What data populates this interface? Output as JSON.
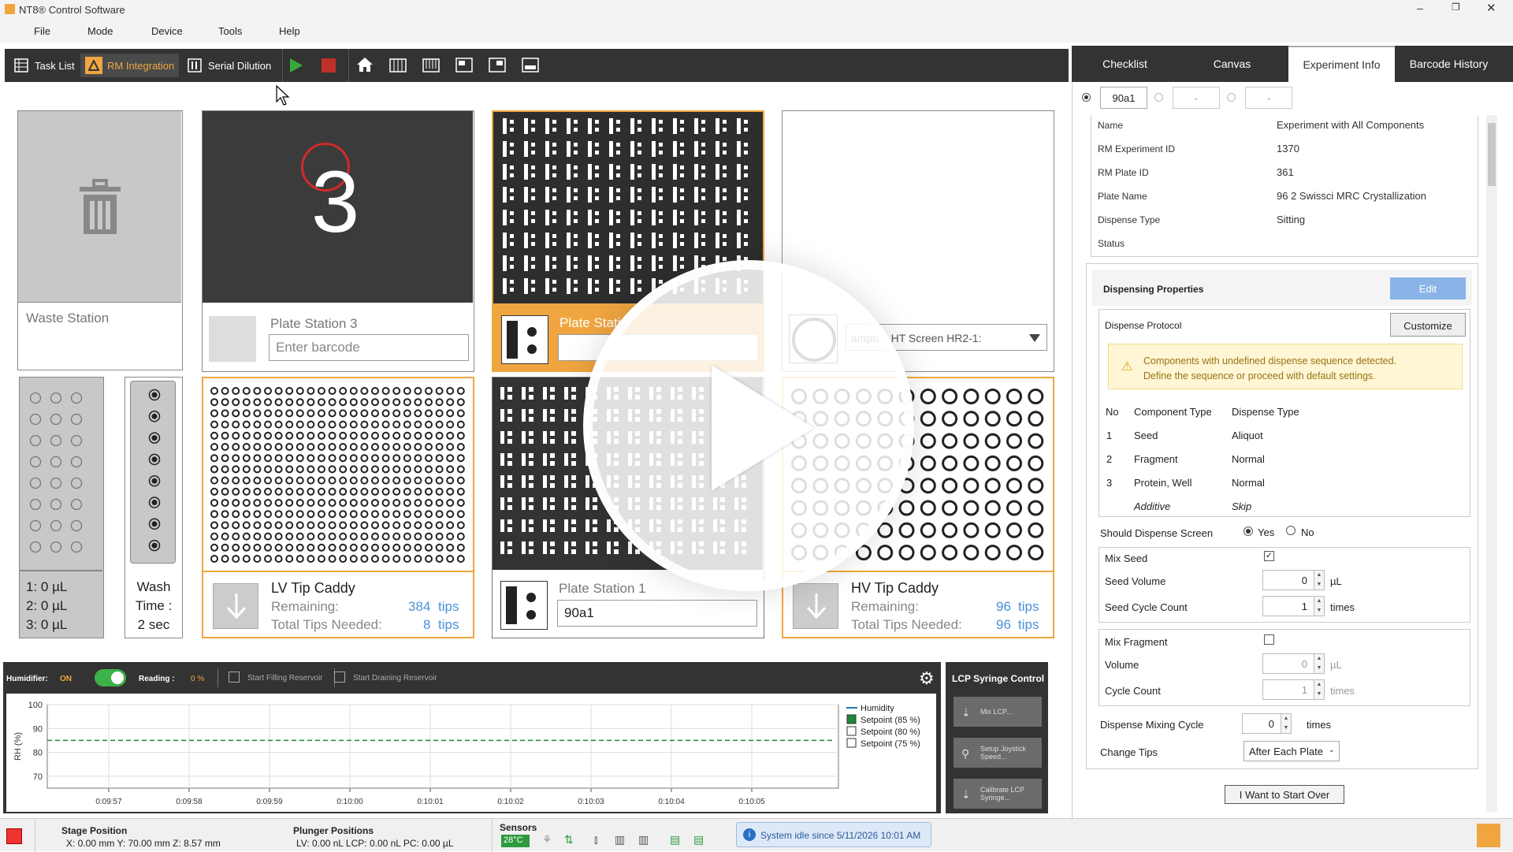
{
  "app": {
    "title": "NT8® Control Software"
  },
  "menu": [
    "File",
    "Mode",
    "Device",
    "Tools",
    "Help"
  ],
  "toolbar": {
    "task_list": "Task List",
    "rm_integration": "RM Integration",
    "serial_dilution": "Serial Dilution"
  },
  "stations": {
    "waste": "Waste Station",
    "plate3": {
      "number": "3",
      "label": "Plate Station 3",
      "placeholder": "Enter barcode"
    },
    "plate2_label": "Plate Statio",
    "screen_select": "ampton HT Screen HR2-1:",
    "plate1": {
      "label": "Plate Station 1",
      "barcode": "90a1"
    },
    "lv_caddy": {
      "title": "LV Tip Caddy",
      "remaining_label": "Remaining:",
      "remaining": "384",
      "needed_label": "Total Tips Needed:",
      "needed": "8",
      "unit": "tips"
    },
    "hv_caddy": {
      "title": "HV Tip Caddy",
      "remaining_label": "Remaining:",
      "remaining": "96",
      "needed_label": "Total Tips Needed:",
      "needed": "96",
      "unit": "tips"
    },
    "volumes": [
      "1: 0 µL",
      "2: 0 µL",
      "3: 0 µL"
    ],
    "wash": [
      "Wash",
      "Time :",
      "2 sec"
    ]
  },
  "humidifier": {
    "label": "Humidifier:",
    "state": "ON",
    "reading_label": "Reading :",
    "reading": "0 %",
    "start_fill": "Start Filling Reservoir",
    "start_drain": "Start Draining Reservoir"
  },
  "chart_data": {
    "type": "line",
    "ylabel": "RH (%)",
    "ylim": [
      65,
      100
    ],
    "y_ticks": [
      "100",
      "90",
      "80",
      "70"
    ],
    "x": [
      "0:09:57",
      "0:09:58",
      "0:09:59",
      "0:10:00",
      "0:10:01",
      "0:10:02",
      "0:10:03",
      "0:10:04",
      "0:10:05"
    ],
    "series": [
      {
        "name": "Humidity",
        "values": []
      },
      {
        "name": "Setpoint (85 %)",
        "values": [
          85,
          85,
          85,
          85,
          85,
          85,
          85,
          85,
          85
        ]
      }
    ],
    "legend": [
      "Humidity",
      "Setpoint (85 %)",
      "Setpoint (80 %)",
      "Setpoint (75 %)"
    ],
    "legend_checked": [
      true,
      true,
      false,
      false
    ],
    "colors": {
      "humidity": "#1f77b4",
      "setpoint": "#1a8a3a"
    }
  },
  "lcp": {
    "title": "LCP Syringe Control",
    "mix": "Mix LCP...",
    "setup": "Setup Joystick Speed...",
    "calibrate": "Calibrate LCP Syringe..."
  },
  "status": {
    "stage_title": "Stage Position",
    "stage": "X: 0.00 mm  Y: 70.00 mm  Z: 8.57 mm",
    "plunger_title": "Plunger Positions",
    "plunger": "LV: 0.00 nL  LCP: 0.00 nL  PC: 0.00 µL",
    "sensors_title": "Sensors",
    "sensor_temp": "28°C",
    "idle": "System idle since 5/11/2026 10:01 AM"
  },
  "tabs": [
    "Checklist",
    "Canvas",
    "Experiment Info",
    "Barcode History"
  ],
  "barcodes": [
    "90a1",
    "-",
    "-"
  ],
  "info": {
    "labels": [
      "Name",
      "RM Experiment ID",
      "RM Plate ID",
      "Plate Name",
      "Dispense Type",
      "Status"
    ],
    "values": [
      "Experiment with All Components",
      "1370",
      "361",
      "96 2 Swissci MRC Crystallization",
      "Sitting",
      ""
    ]
  },
  "dispensing": {
    "title": "Dispensing Properties",
    "edit": "Edit",
    "protocol_label": "Dispense Protocol",
    "customize": "Customize",
    "warning": [
      "Components with undefined dispense sequence detected.",
      "Define the sequence or proceed with default settings."
    ],
    "headers": [
      "No",
      "Component Type",
      "Dispense Type"
    ],
    "rows": [
      [
        "1",
        "Seed",
        "Aliquot"
      ],
      [
        "2",
        "Fragment",
        "Normal"
      ],
      [
        "3",
        "Protein, Well",
        "Normal"
      ],
      [
        "",
        "Additive",
        "Skip"
      ]
    ],
    "should_dispense": "Should Dispense Screen",
    "yes": "Yes",
    "no": "No",
    "mix_seed": "Mix Seed",
    "seed_volume": "Seed Volume",
    "seed_volume_val": "0",
    "ul": "µL",
    "seed_cycle": "Seed Cycle Count",
    "seed_cycle_val": "1",
    "times": "times",
    "mix_fragment": "Mix Fragment",
    "volume": "Volume",
    "volume_val": "0",
    "cycle_count": "Cycle Count",
    "cycle_val": "1",
    "mixing_cycle": "Dispense Mixing Cycle",
    "mixing_val": "0",
    "change_tips": "Change Tips",
    "change_tips_val": "After Each Plate",
    "start_over": "I Want to Start Over"
  },
  "colors": {
    "accent": "#f0a640",
    "dark": "#333333",
    "edit_btn": "#8ab4e8",
    "warn_bg": "#fff6d6"
  }
}
